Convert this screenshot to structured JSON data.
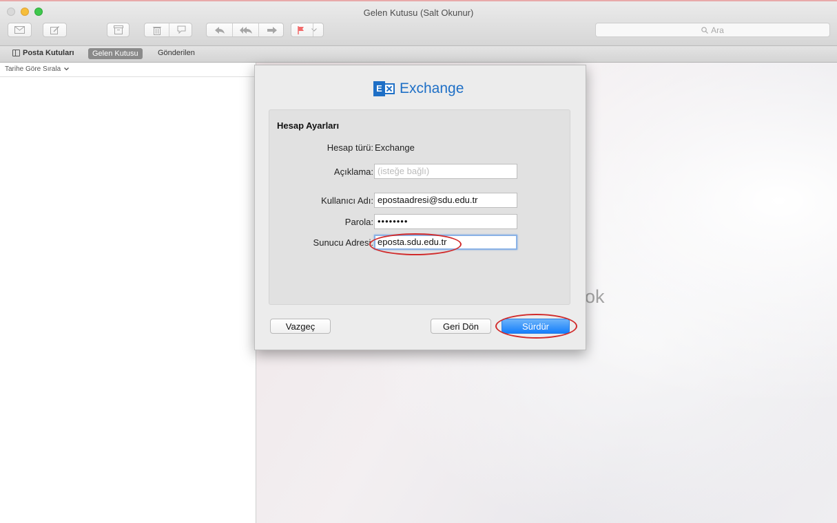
{
  "window": {
    "title": "Gelen Kutusu (Salt Okunur)"
  },
  "toolbar": {
    "icons": [
      "envelope-icon",
      "compose-icon",
      "archive-icon",
      "trash-icon",
      "junk-icon",
      "reply-icon",
      "reply-all-icon",
      "forward-icon",
      "flag-icon",
      "chevron-down-icon"
    ],
    "flag_color": "#f26b6b",
    "search_placeholder": "Ara"
  },
  "favorites": {
    "mailboxes_label": "Posta Kutuları",
    "inbox_label": "Gelen Kutusu",
    "sent_label": "Gönderilen"
  },
  "message_list": {
    "sort_label": "Tarihe Göre Sırala"
  },
  "viewer": {
    "empty_text_fragment": "ok"
  },
  "dialog": {
    "brand_letter": "E",
    "brand_name": "Exchange",
    "brand_color": "#1e6fc6",
    "section_title": "Hesap Ayarları",
    "account_type_label": "Hesap türü:",
    "account_type_value": "Exchange",
    "description_label": "Açıklama:",
    "description_placeholder": "(isteğe bağlı)",
    "username_label": "Kullanıcı Adı:",
    "username_value": "epostaadresi@sdu.edu.tr",
    "password_label": "Parola:",
    "password_value": "••••••••",
    "server_label": "Sunucu Adresi:",
    "server_value": "eposta.sdu.edu.tr",
    "cancel_label": "Vazgeç",
    "back_label": "Geri Dön",
    "continue_label": "Sürdür",
    "annotation_color": "#d12a2a"
  }
}
